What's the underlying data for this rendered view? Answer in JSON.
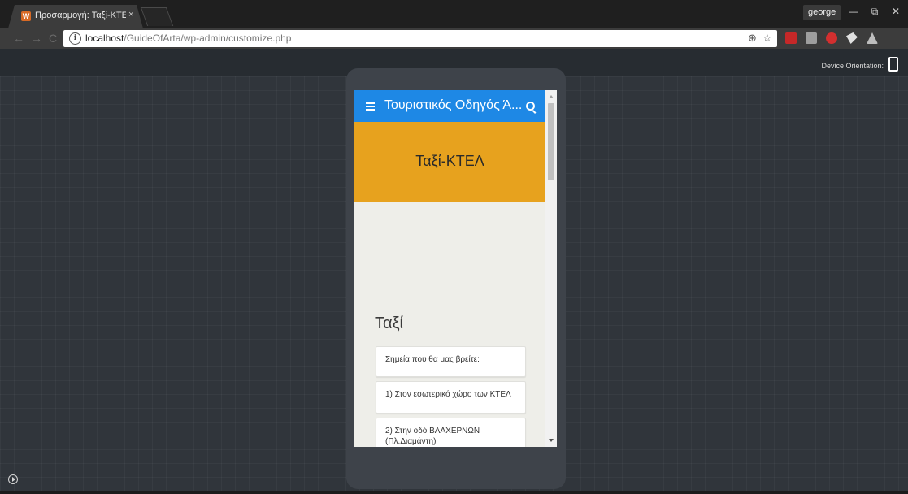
{
  "browser": {
    "tab_title": "Προσαρμογή: Ταξί-ΚΤΕΛ",
    "tab_favicon": "wordpress-favicon",
    "tab_close": "×",
    "profile_name": "george",
    "url_host": "localhost",
    "url_path": "/GuideOfArta/wp-admin/customize.php",
    "win_minimize": "—",
    "win_restore": "⧉",
    "win_close": "✕"
  },
  "customizer": {
    "device_orientation_label": "Device Orientation:"
  },
  "site": {
    "title": "Τουριστικός Οδηγός Ά...",
    "page_title": "Ταξί-ΚΤΕΛ",
    "section_heading": "Ταξί",
    "cards": [
      "Σημεία που θα μας βρείτε:",
      "1) Στον εσωτερικό χώρο των ΚΤΕΛ",
      "2) Στην οδό ΒΛΑΧΕΡΝΩΝ (Πλ.Διαμάντη)"
    ]
  },
  "colors": {
    "app_bar": "#1e88e5",
    "hero": "#e7a21e",
    "tab_favicon": "#d86a25"
  },
  "icons": {
    "zoom": "zoom-icon",
    "bookmark": "star-icon",
    "info": "info-icon",
    "menu": "hamburger-icon",
    "search": "search-icon"
  }
}
